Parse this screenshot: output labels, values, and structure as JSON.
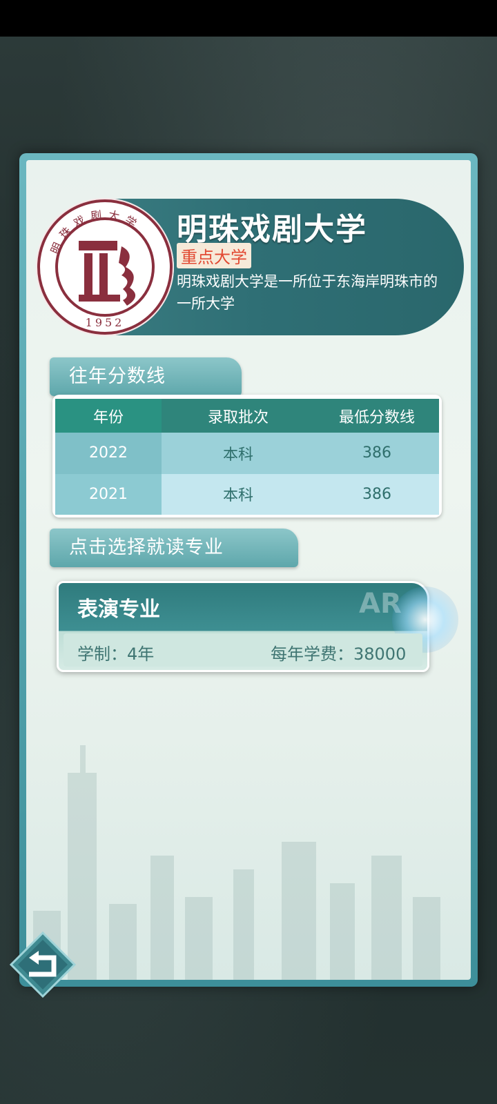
{
  "school": {
    "name": "明珠戏剧大学",
    "tag": "重点大学",
    "description": "明珠戏剧大学是一所位于东海岸明珠市的一所大学",
    "emblem": {
      "ring_text": "明珠戏剧大学",
      "year": "1952"
    }
  },
  "sections": {
    "scores_label": "往年分数线",
    "choose_major_label": "点击选择就读专业"
  },
  "score_table": {
    "headers": [
      "年份",
      "录取批次",
      "最低分数线"
    ],
    "rows": [
      {
        "year": "2022",
        "batch": "本科",
        "min_score": "386"
      },
      {
        "year": "2021",
        "batch": "本科",
        "min_score": "386"
      }
    ]
  },
  "majors": [
    {
      "name": "表演专业",
      "years": "学制：4年",
      "fee": "每年学费：38000"
    }
  ],
  "badge_text": "AR",
  "colors": {
    "accent_teal": "#2f857b",
    "tag_red": "#e24a33",
    "emblem_maroon": "#8a2f3e"
  },
  "icons": {
    "back": "back-arrow-icon"
  }
}
